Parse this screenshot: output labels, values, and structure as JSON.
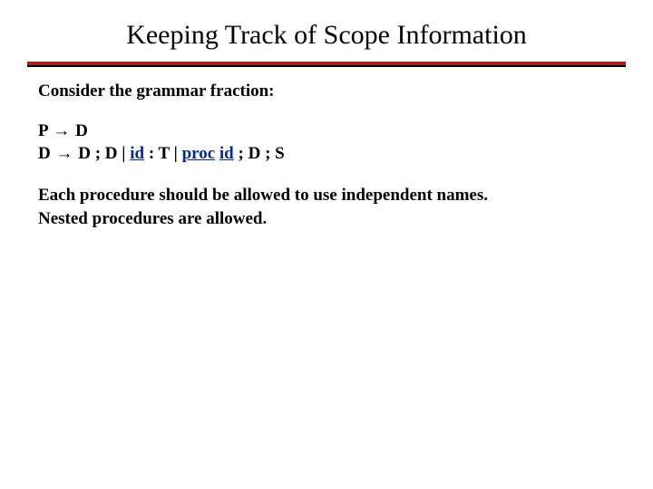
{
  "title": "Keeping Track of Scope Information",
  "intro": "Consider the grammar fraction:",
  "grammar": {
    "line1": {
      "lhs": "P",
      "arrow": "→",
      "rhs": "D"
    },
    "line2": {
      "lhs": "D",
      "arrow": "→",
      "seg1": "D ; D | ",
      "kw_id1": "id",
      "seg2": " : T | ",
      "kw_proc": "proc",
      "seg3": " ",
      "kw_id2": "id",
      "seg4": " ; D ; S"
    }
  },
  "explain_line1": "Each procedure should be allowed to use independent names.",
  "explain_line2": "Nested procedures are allowed."
}
